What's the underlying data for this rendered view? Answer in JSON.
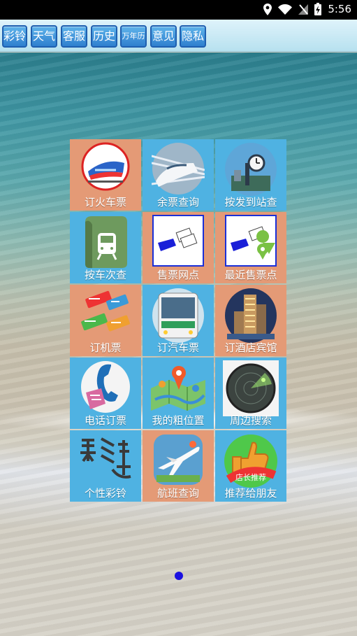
{
  "status_bar": {
    "time": "5:56",
    "icons": [
      "location-icon",
      "wifi-icon",
      "no-signal-icon",
      "battery-charging-icon"
    ]
  },
  "toolbar": {
    "buttons": [
      {
        "label": "彩铃"
      },
      {
        "label": "天气"
      },
      {
        "label": "客服"
      },
      {
        "label": "历史"
      },
      {
        "label": "万年历"
      },
      {
        "label": "意见"
      },
      {
        "label": "隐私"
      }
    ]
  },
  "grid": {
    "items": [
      {
        "label": "订火车票",
        "icon": "train-ticket-icon"
      },
      {
        "label": "余票查询",
        "icon": "bullet-train-icon"
      },
      {
        "label": "按发到站查",
        "icon": "station-clock-icon"
      },
      {
        "label": "按车次查",
        "icon": "train-front-icon"
      },
      {
        "label": "售票网点",
        "icon": "ticket-hand-icon"
      },
      {
        "label": "最近售票点",
        "icon": "ticket-location-icon"
      },
      {
        "label": "订机票",
        "icon": "air-ticket-icon"
      },
      {
        "label": "订汽车票",
        "icon": "bus-icon"
      },
      {
        "label": "订酒店宾馆",
        "icon": "hotel-icon"
      },
      {
        "label": "电话订票",
        "icon": "phone-icon"
      },
      {
        "label": "我的粗位置",
        "icon": "map-pin-icon"
      },
      {
        "label": "周边搜索",
        "icon": "radar-icon"
      },
      {
        "label": "个性彩铃",
        "icon": "ringtone-icon"
      },
      {
        "label": "航班查询",
        "icon": "airplane-icon"
      },
      {
        "label": "推荐给朋友",
        "icon": "thumbs-up-icon"
      }
    ],
    "seal_text": "店长推荐"
  },
  "pager": {
    "current": 1,
    "total": 1
  },
  "colors": {
    "orange_cell": "#e49a76",
    "blue_cell": "#4fb2e2",
    "pager_dot": "#1a10e0"
  }
}
